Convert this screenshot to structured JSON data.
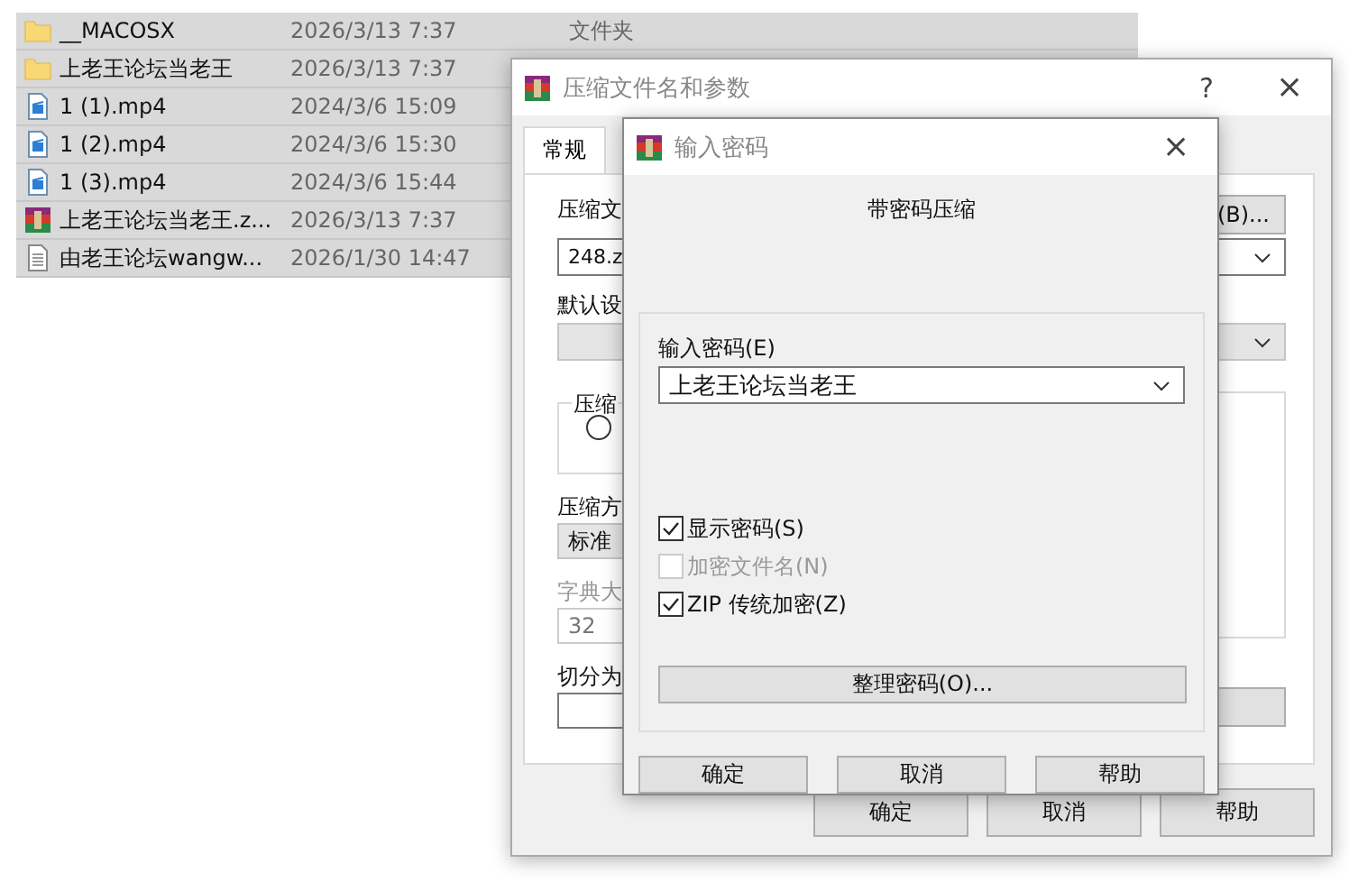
{
  "file_list": {
    "rows": [
      {
        "kind": "folder",
        "name": "__MACOSX",
        "modified": "2026/3/13 7:37",
        "type": "文件夹",
        "selected": true
      },
      {
        "kind": "folder",
        "name": "上老王论坛当老王",
        "modified": "2026/3/13 7:37",
        "selected": true
      },
      {
        "kind": "video",
        "name": "1 (1).mp4",
        "modified": "2024/3/6 15:09",
        "selected": true
      },
      {
        "kind": "video",
        "name": "1 (2).mp4",
        "modified": "2024/3/6 15:30",
        "selected": true
      },
      {
        "kind": "video",
        "name": "1 (3).mp4",
        "modified": "2024/3/6 15:44",
        "selected": true
      },
      {
        "kind": "archive",
        "name": "上老王论坛当老王.z...",
        "modified": "2026/3/13 7:37",
        "selected": true
      },
      {
        "kind": "text",
        "name": "由老王论坛wangw...",
        "modified": "2026/1/30 14:47",
        "selected": true
      }
    ]
  },
  "archive_dialog": {
    "title": "压缩文件名和参数",
    "help": "?",
    "close": "×",
    "tabs": [
      {
        "label": "常规",
        "selected": true
      }
    ],
    "archive_name_label": "压缩文",
    "browse_button": "(B)...",
    "archive_name": "248.z",
    "profile_label": "默认设",
    "format_group": "压缩",
    "format_radio": {
      "selected": false
    },
    "method_label": "压缩方",
    "method": "标准",
    "dictionary_label": "字典大",
    "dictionary": "32",
    "split_label": "切分为",
    "buttons": [
      "确定",
      "取消",
      "帮助"
    ]
  },
  "password_dialog": {
    "title": "输入密码",
    "close": "×",
    "heading": "带密码压缩",
    "password_label": "输入密码(E)",
    "password": "上老王论坛当老王",
    "options": [
      {
        "label": "显示密码(S)",
        "checked": true,
        "disabled": false
      },
      {
        "label": "加密文件名(N)",
        "checked": false,
        "disabled": true
      },
      {
        "label": "ZIP 传统加密(Z)",
        "checked": true,
        "disabled": false
      }
    ],
    "organize_button": "整理密码(O)...",
    "buttons": [
      "确定",
      "取消",
      "帮助"
    ]
  }
}
